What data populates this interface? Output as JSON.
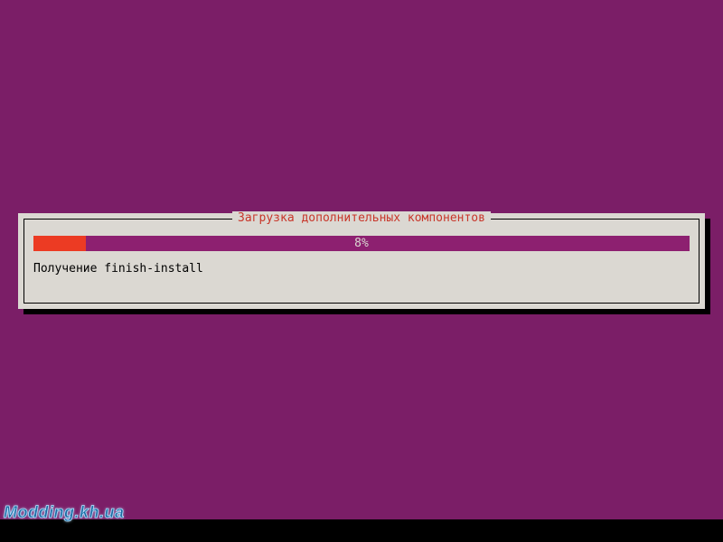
{
  "installer": {
    "dialog_title": "Загрузка дополнительных компонентов",
    "progress": {
      "percent_label": "8%",
      "percent_value": 8
    },
    "status_line": "Получение finish-install"
  },
  "watermark": "Modding.kh.ua",
  "colors": {
    "background": "#7b1e67",
    "dialog_face": "#dbd8d2",
    "title_text": "#c8362a",
    "bar_track": "#8d2070",
    "bar_fill": "#ec3b23"
  }
}
